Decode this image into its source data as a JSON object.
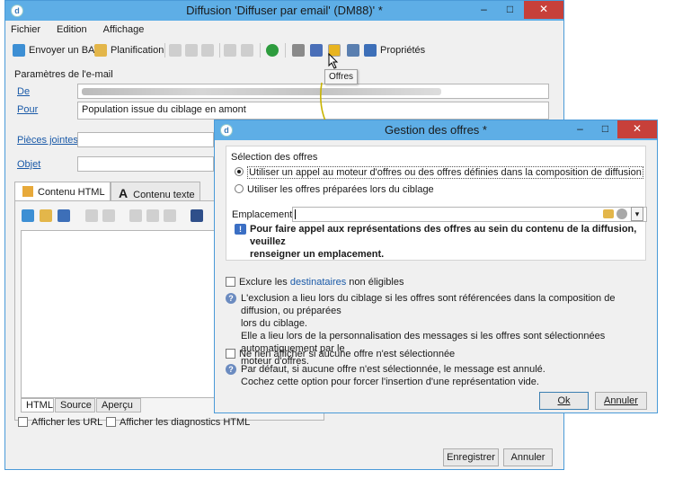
{
  "main_window": {
    "title": "Diffusion 'Diffuser par email' (DM88)' *",
    "menu": [
      "Fichier",
      "Edition",
      "Affichage"
    ],
    "toolbar": {
      "send_bat": "Envoyer un BAT",
      "planning": "Planification",
      "properties": "Propriétés"
    },
    "email_params_title": "Paramètres de l'e-mail",
    "fields": {
      "from_label": "De",
      "to_label": "Pour",
      "to_value": "Population issue du ciblage en amont",
      "attachments_label": "Pièces jointes",
      "subject_label": "Objet"
    },
    "tabs": [
      "Contenu HTML",
      "Contenu texte"
    ],
    "bottom_tabs": [
      "HTML",
      "Source",
      "Aperçu"
    ],
    "show_urls": "Afficher les URL",
    "show_html_diag": "Afficher les diagnostics HTML",
    "save_button": "Enregistrer",
    "cancel_button": "Annuler"
  },
  "tooltip": "Offres",
  "dialog": {
    "title": "Gestion des offres *",
    "section_title": "Sélection des offres",
    "radio_1": "Utiliser un appel au moteur d'offres ou des offres définies dans la composition de diffusion",
    "radio_2": "Utiliser les offres préparées lors du ciblage",
    "location_label": "Emplacement:",
    "info_line_1": "Pour faire appel aux représentations des offres au sein du contenu de la diffusion, veuillez",
    "info_line_2": "renseigner un emplacement.",
    "exclude_prefix": "Exclure les ",
    "exclude_link": "destinataires",
    "exclude_suffix": " non éligibles",
    "exclude_help_1": "L'exclusion a lieu lors du ciblage si les offres sont référencées dans la composition de diffusion, ou préparées",
    "exclude_help_2": "lors du ciblage.",
    "exclude_help_3": "Elle a lieu lors de la personnalisation des messages si les offres sont sélectionnées automatiquement par le",
    "exclude_help_4": "moteur d'offres.",
    "no_offer_label": "Ne rien afficher si aucune offre n'est sélectionnée",
    "no_offer_help_1": "Par défaut, si aucune offre n'est sélectionnée, le message est annulé.",
    "no_offer_help_2": "Cochez cette option pour forcer l'insertion d'une représentation vide.",
    "ok_button": "Ok",
    "cancel_button": "Annuler"
  },
  "colors": {
    "titlebar": "#5eaee6",
    "close": "#c7403a",
    "arrow": "#c8b400",
    "link": "#1a5aa8"
  }
}
